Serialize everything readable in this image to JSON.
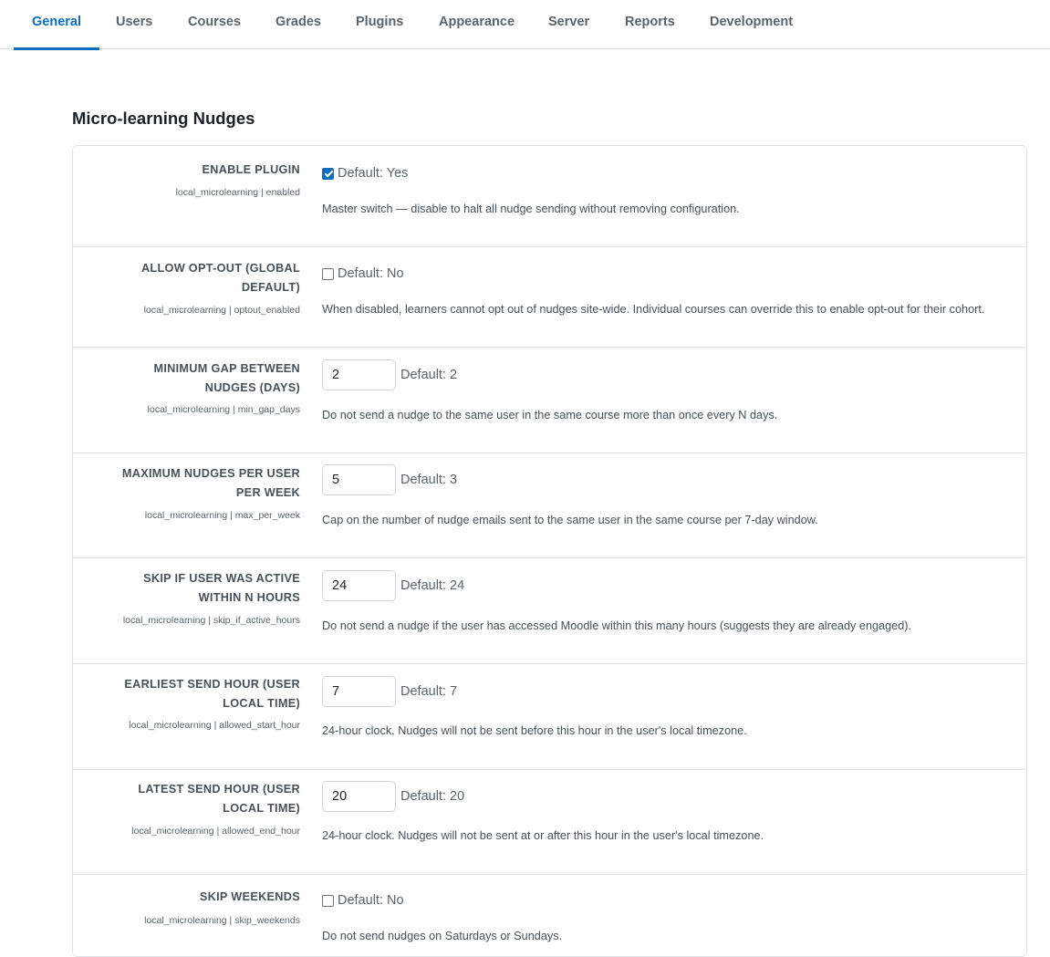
{
  "tabs": [
    {
      "label": "General",
      "active": true
    },
    {
      "label": "Users"
    },
    {
      "label": "Courses"
    },
    {
      "label": "Grades"
    },
    {
      "label": "Plugins"
    },
    {
      "label": "Appearance"
    },
    {
      "label": "Server"
    },
    {
      "label": "Reports"
    },
    {
      "label": "Development"
    }
  ],
  "section": {
    "title": "Micro-learning Nudges"
  },
  "colors": {
    "accent": "#0f6cbf",
    "border": "#dee2e6",
    "label": "#495057"
  },
  "settings": [
    {
      "label": "Enable plugin",
      "key": "local_microlearning | enabled",
      "type": "checkbox",
      "checked": true,
      "default": "Default: Yes",
      "description": "Master switch — disable to halt all nudge sending without removing configuration."
    },
    {
      "label": "Allow opt-out (global default)",
      "key": "local_microlearning | optout_enabled",
      "type": "checkbox",
      "checked": false,
      "default": "Default: No",
      "description": "When disabled, learners cannot opt out of nudges site-wide. Individual courses can override this to enable opt-out for their cohort."
    },
    {
      "label": "Minimum gap between nudges (days)",
      "key": "local_microlearning | min_gap_days",
      "type": "text",
      "value": "2",
      "default": "Default: 2",
      "description": "Do not send a nudge to the same user in the same course more than once every N days."
    },
    {
      "label": "Maximum nudges per user per week",
      "key": "local_microlearning | max_per_week",
      "type": "text",
      "value": "5",
      "default": "Default: 3",
      "description": "Cap on the number of nudge emails sent to the same user in the same course per 7-day window."
    },
    {
      "label": "Skip if user was active within N hours",
      "key": "local_microlearning | skip_if_active_hours",
      "type": "text",
      "value": "24",
      "default": "Default: 24",
      "description": "Do not send a nudge if the user has accessed Moodle within this many hours (suggests they are already engaged)."
    },
    {
      "label": "Earliest send hour (user local time)",
      "key": "local_microlearning | allowed_start_hour",
      "type": "text",
      "value": "7",
      "default": "Default: 7",
      "description": "24-hour clock. Nudges will not be sent before this hour in the user's local timezone."
    },
    {
      "label": "Latest send hour (user local time)",
      "key": "local_microlearning | allowed_end_hour",
      "type": "text",
      "value": "20",
      "default": "Default: 20",
      "description": "24-hour clock. Nudges will not be sent at or after this hour in the user's local timezone."
    },
    {
      "label": "Skip weekends",
      "key": "local_microlearning | skip_weekends",
      "type": "checkbox",
      "checked": false,
      "default": "Default: No",
      "description": "Do not send nudges on Saturdays or Sundays."
    }
  ]
}
